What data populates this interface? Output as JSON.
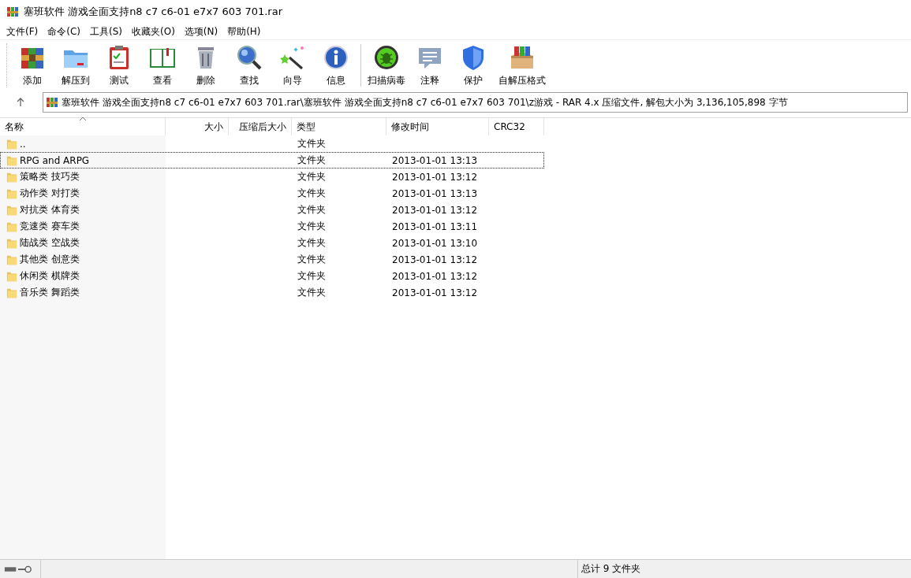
{
  "window": {
    "title": "塞班软件 游戏全面支持n8 c7 c6-01 e7x7 603 701.rar"
  },
  "menu": [
    "文件(F)",
    "命令(C)",
    "工具(S)",
    "收藏夹(O)",
    "选项(N)",
    "帮助(H)"
  ],
  "toolbar": {
    "groups": [
      [
        "添加",
        "解压到",
        "测试",
        "查看",
        "删除",
        "查找",
        "向导",
        "信息"
      ],
      [
        "扫描病毒",
        "注释",
        "保护",
        "自解压格式"
      ]
    ]
  },
  "address": {
    "path": "塞班软件 游戏全面支持n8 c7 c6-01 e7x7 603 701.rar\\塞班软件 游戏全面支持n8 c7 c6-01 e7x7 603 701\\z游戏 - RAR 4.x 压缩文件, 解包大小为 3,136,105,898 字节"
  },
  "table": {
    "columns": [
      {
        "label": "名称",
        "sorted": true
      },
      {
        "label": "大小",
        "sorted": false
      },
      {
        "label": "压缩后大小",
        "sorted": false
      },
      {
        "label": "类型",
        "sorted": false
      },
      {
        "label": "修改时间",
        "sorted": false
      },
      {
        "label": "CRC32",
        "sorted": false
      }
    ],
    "rows": [
      {
        "name": "..",
        "type": "文件夹",
        "modified": "",
        "focused": false
      },
      {
        "name": "RPG and ARPG",
        "type": "文件夹",
        "modified": "2013-01-01 13:13",
        "focused": true
      },
      {
        "name": "策略类 技巧类",
        "type": "文件夹",
        "modified": "2013-01-01 13:12",
        "focused": false
      },
      {
        "name": "动作类 对打类",
        "type": "文件夹",
        "modified": "2013-01-01 13:13",
        "focused": false
      },
      {
        "name": "对抗类 体育类",
        "type": "文件夹",
        "modified": "2013-01-01 13:12",
        "focused": false
      },
      {
        "name": "竞速类 赛车类",
        "type": "文件夹",
        "modified": "2013-01-01 13:11",
        "focused": false
      },
      {
        "name": "陆战类 空战类",
        "type": "文件夹",
        "modified": "2013-01-01 13:10",
        "focused": false
      },
      {
        "name": "其他类 创意类",
        "type": "文件夹",
        "modified": "2013-01-01 13:12",
        "focused": false
      },
      {
        "name": "休闲类 棋牌类",
        "type": "文件夹",
        "modified": "2013-01-01 13:12",
        "focused": false
      },
      {
        "name": "音乐类 舞蹈类",
        "type": "文件夹",
        "modified": "2013-01-01 13:12",
        "focused": false
      }
    ]
  },
  "status_bar": {
    "summary": "总计 9 文件夹"
  }
}
